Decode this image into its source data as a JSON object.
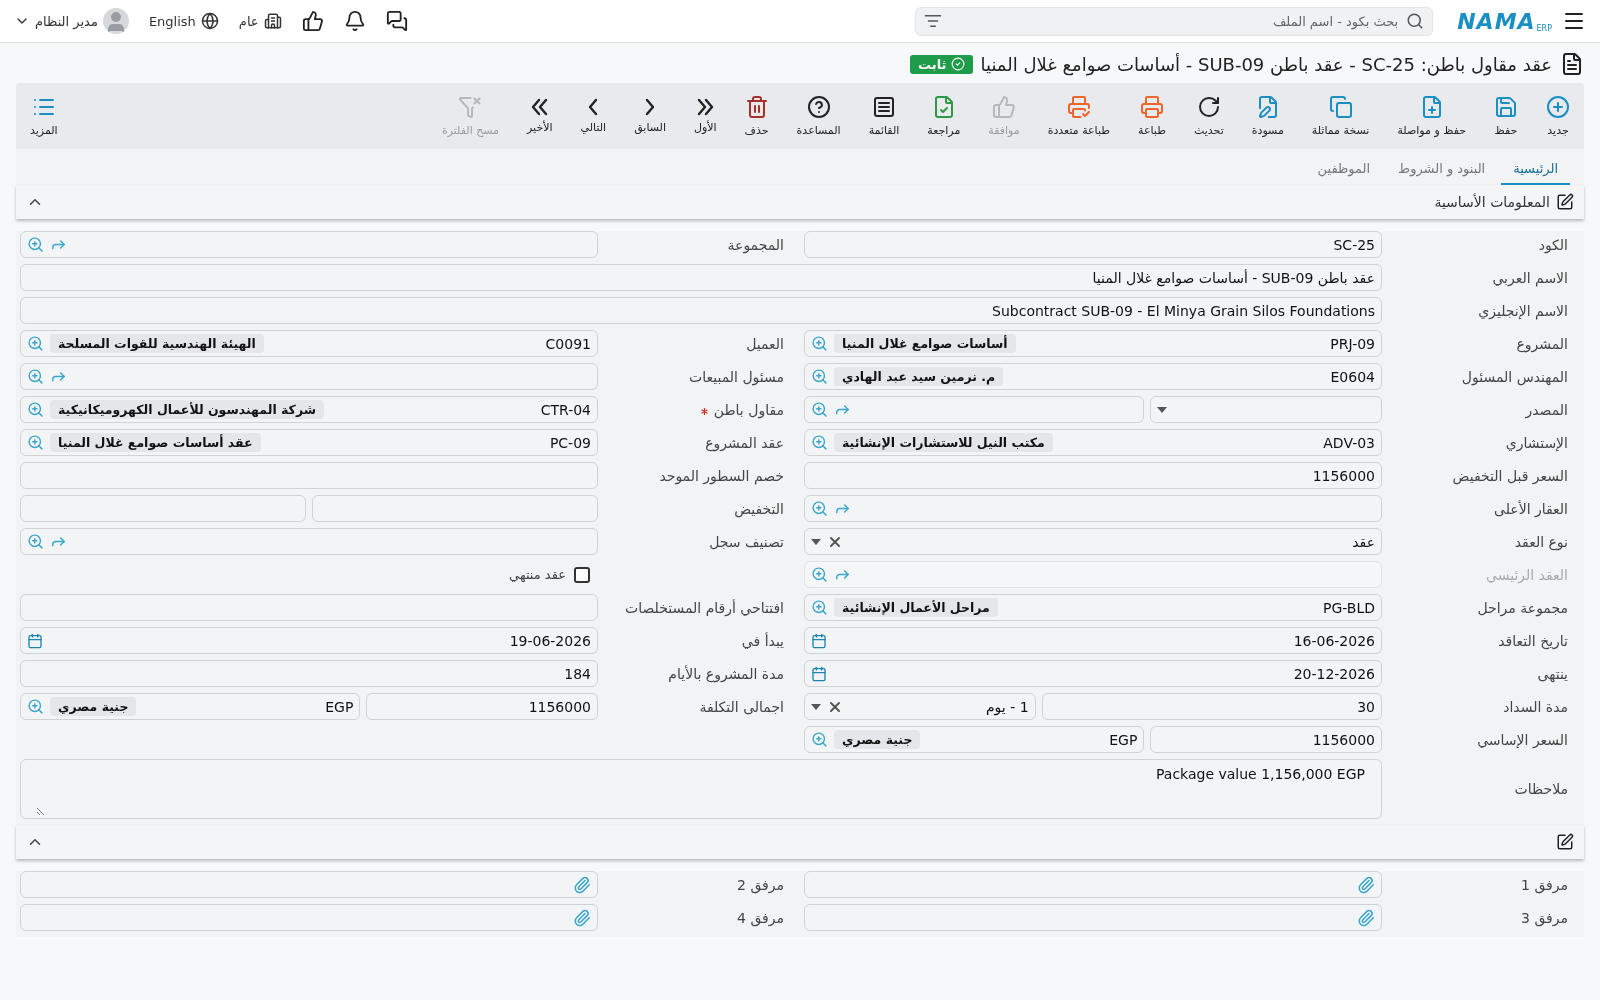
{
  "topbar": {
    "logo": {
      "name": "NAMA",
      "sub": "ERP"
    },
    "search": {
      "placeholder": "بحث بكود - اسم الملف"
    },
    "company": "عام",
    "language": "English",
    "user": "مدير النظام"
  },
  "title": {
    "text": "عقد مقاول باطن: SC-25 - عقد باطن SUB-09 - أساسات صوامع غلال المنيا",
    "status": "ثابت"
  },
  "toolbar": {
    "buttons": [
      {
        "kind": "new",
        "label": "جديد",
        "disabled": false
      },
      {
        "kind": "save",
        "label": "حفظ",
        "disabled": false
      },
      {
        "kind": "save_continue",
        "label": "حفظ و مواصلة",
        "disabled": false
      },
      {
        "kind": "duplicate",
        "label": "نسخة مماثلة",
        "disabled": false
      },
      {
        "kind": "draft",
        "label": "مسودة",
        "disabled": false
      },
      {
        "kind": "refresh",
        "label": "تحديث",
        "disabled": false
      },
      {
        "kind": "print",
        "label": "طباعة",
        "disabled": false
      },
      {
        "kind": "print_multi",
        "label": "طباعة متعددة",
        "disabled": false
      },
      {
        "kind": "approve",
        "label": "موافقة",
        "disabled": true
      },
      {
        "kind": "review",
        "label": "مراجعة",
        "disabled": false
      },
      {
        "kind": "list",
        "label": "القائمة",
        "disabled": false
      },
      {
        "kind": "help",
        "label": "المساعدة",
        "disabled": false
      },
      {
        "kind": "delete",
        "label": "حذف",
        "disabled": false
      },
      {
        "kind": "first",
        "label": "الأول",
        "disabled": false
      },
      {
        "kind": "prev",
        "label": "السابق",
        "disabled": false
      },
      {
        "kind": "next",
        "label": "التالي",
        "disabled": false
      },
      {
        "kind": "last",
        "label": "الأخير",
        "disabled": false
      },
      {
        "kind": "clear_filter",
        "label": "مسح الفلترة",
        "disabled": true
      }
    ],
    "more": {
      "label": "المزيد"
    }
  },
  "tabs": [
    {
      "label": "الرئيسية",
      "selected": true
    },
    {
      "label": "البنود و الشروط",
      "selected": false
    },
    {
      "label": "الموظفين",
      "selected": false
    }
  ],
  "sections": [
    {
      "title": "المعلومات الأساسية",
      "expanded": true,
      "rows": [
        {
          "cells": [
            {
              "label": "الكود",
              "inputs": [
                {
                  "kind": "text",
                  "value": "SC-25"
                }
              ]
            },
            {
              "label": "المجموعة",
              "inputs": [
                {
                  "kind": "lookup",
                  "link": true
                }
              ]
            }
          ]
        },
        {
          "cells": [
            {
              "label": "الاسم العربي",
              "wide": true,
              "inputs": [
                {
                  "kind": "text",
                  "value": "عقد باطن SUB-09 - أساسات صوامع غلال المنيا"
                }
              ]
            }
          ]
        },
        {
          "cells": [
            {
              "label": "الاسم الإنجليزي",
              "wide": true,
              "inputs": [
                {
                  "kind": "text",
                  "value": "Subcontract SUB-09 - El Minya Grain Silos Foundations"
                }
              ]
            }
          ]
        },
        {
          "cells": [
            {
              "label": "المشروع",
              "inputs": [
                {
                  "kind": "lookup",
                  "code": "PRJ-09",
                  "name": "أساسات صوامع غلال المنيا",
                  "link": false
                }
              ]
            },
            {
              "label": "العميل",
              "inputs": [
                {
                  "kind": "lookup",
                  "code": "C0091",
                  "name": "الهيئة الهندسية للقوات المسلحة",
                  "link": false
                }
              ]
            }
          ]
        },
        {
          "cells": [
            {
              "label": "المهندس المسئول",
              "inputs": [
                {
                  "kind": "lookup",
                  "code": "E0604",
                  "name": "م. نرمين سيد عبد الهادي",
                  "link": false
                }
              ]
            },
            {
              "label": "مسئول المبيعات",
              "inputs": [
                {
                  "kind": "lookup",
                  "link": true
                }
              ]
            }
          ]
        },
        {
          "cells": [
            {
              "label": "المصدر",
              "inputs": [
                {
                  "kind": "select",
                  "clearable": false
                },
                {
                  "kind": "lookup",
                  "link": true
                }
              ]
            },
            {
              "label": "مقاول باطن",
              "required": true,
              "inputs": [
                {
                  "kind": "lookup",
                  "code": "CTR-04",
                  "name": "شركة المهندسون للأعمال الكهروميكانيكية",
                  "link": false
                }
              ]
            }
          ]
        },
        {
          "cells": [
            {
              "label": "الإستشاري",
              "inputs": [
                {
                  "kind": "lookup",
                  "code": "ADV-03",
                  "name": "مكتب النيل للاستشارات الإنشائية",
                  "link": false
                }
              ]
            },
            {
              "label": "عقد المشروع",
              "inputs": [
                {
                  "kind": "lookup",
                  "code": "PC-09",
                  "name": "عقد أساسات صوامع غلال المنيا",
                  "link": false
                }
              ]
            }
          ]
        },
        {
          "cells": [
            {
              "label": "السعر قبل التخفيض",
              "inputs": [
                {
                  "kind": "text",
                  "value": "1156000"
                }
              ]
            },
            {
              "label": "خصم السطور الموحد",
              "inputs": [
                {
                  "kind": "text"
                }
              ]
            }
          ]
        },
        {
          "cells": [
            {
              "label": "العقار الأعلى",
              "inputs": [
                {
                  "kind": "lookup",
                  "link": true
                }
              ]
            },
            {
              "label": "التخفيض",
              "inputs": [
                {
                  "kind": "text"
                },
                {
                  "kind": "text"
                }
              ]
            }
          ]
        },
        {
          "cells": [
            {
              "label": "نوع العقد",
              "inputs": [
                {
                  "kind": "select",
                  "value": "عقد",
                  "clearable": true
                }
              ]
            },
            {
              "label": "تصنيف سجل",
              "inputs": [
                {
                  "kind": "lookup",
                  "link": true
                }
              ]
            }
          ]
        },
        {
          "cells": [
            {
              "label": "العقد الرئيسي",
              "disabled": true,
              "inputs": [
                {
                  "kind": "lookup",
                  "link": true
                }
              ]
            },
            {
              "kind": "checkbox",
              "label": "عقد منتهي",
              "checked": false
            }
          ]
        },
        {
          "cells": [
            {
              "label": "مجموعة مراحل",
              "inputs": [
                {
                  "kind": "lookup",
                  "code": "PG-BLD",
                  "name": "مراحل الأعمال الإنشائية",
                  "link": false
                }
              ]
            },
            {
              "label": "افتتاحي أرقام المستخلصات",
              "inputs": [
                {
                  "kind": "text"
                }
              ]
            }
          ]
        },
        {
          "cells": [
            {
              "label": "تاريخ التعاقد",
              "inputs": [
                {
                  "kind": "date",
                  "value": "16-06-2026"
                }
              ]
            },
            {
              "label": "يبدأ في",
              "inputs": [
                {
                  "kind": "date",
                  "value": "19-06-2026"
                }
              ]
            }
          ]
        },
        {
          "cells": [
            {
              "label": "ينتهى",
              "inputs": [
                {
                  "kind": "date",
                  "value": "20-12-2026"
                }
              ]
            },
            {
              "label": "مدة المشروع بالأيام",
              "inputs": [
                {
                  "kind": "text",
                  "value": "184"
                }
              ]
            }
          ]
        },
        {
          "cells": [
            {
              "label": "مدة السداد",
              "inputs": [
                {
                  "kind": "text",
                  "value": "30"
                },
                {
                  "kind": "select",
                  "value": "1 - يوم",
                  "clearable": true
                }
              ]
            },
            {
              "label": "اجمالى التكلفة",
              "inputs": [
                {
                  "kind": "text",
                  "value": "1156000"
                },
                {
                  "kind": "lookup",
                  "code": "EGP",
                  "name": "جنية مصري",
                  "link": false
                }
              ]
            }
          ]
        },
        {
          "cells": [
            {
              "label": "السعر الإساسي",
              "inputs": [
                {
                  "kind": "text",
                  "value": "1156000"
                },
                {
                  "kind": "lookup",
                  "code": "EGP",
                  "name": "جنية مصري",
                  "link": false
                }
              ]
            }
          ]
        },
        {
          "cells": [
            {
              "label": "ملاحظات",
              "wide": true,
              "inputs": [
                {
                  "kind": "notes",
                  "value": "Package value 1,156,000 EGP"
                }
              ]
            }
          ]
        }
      ]
    },
    {
      "expanded": true,
      "rows": [
        {
          "cells": [
            {
              "label": "مرفق 1",
              "inputs": [
                {
                  "kind": "file"
                }
              ]
            },
            {
              "label": "مرفق 2",
              "inputs": [
                {
                  "kind": "file"
                }
              ]
            }
          ]
        },
        {
          "cells": [
            {
              "label": "مرفق 3",
              "inputs": [
                {
                  "kind": "file"
                }
              ]
            },
            {
              "label": "مرفق 4",
              "inputs": [
                {
                  "kind": "file"
                }
              ]
            }
          ]
        }
      ]
    }
  ]
}
